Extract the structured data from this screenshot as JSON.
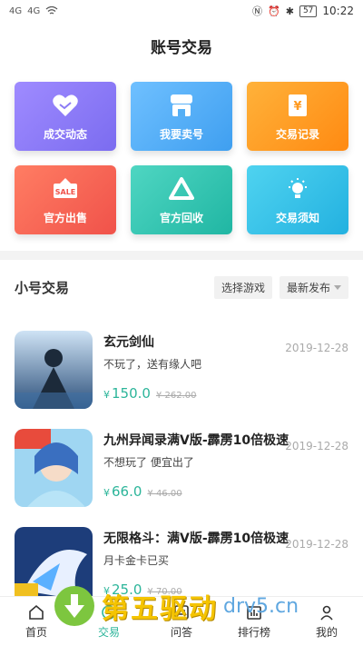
{
  "status": {
    "time": "10:22",
    "battery": "57",
    "signal1": "4G",
    "signal2": "4G"
  },
  "page_title": "账号交易",
  "tiles": [
    {
      "label": "成交动态",
      "icon": "handshake-icon"
    },
    {
      "label": "我要卖号",
      "icon": "shop-icon"
    },
    {
      "label": "交易记录",
      "icon": "receipt-icon"
    },
    {
      "label": "官方出售",
      "icon": "sale-tag-icon",
      "badge": "SALE"
    },
    {
      "label": "官方回收",
      "icon": "recycle-icon"
    },
    {
      "label": "交易须知",
      "icon": "lightbulb-icon"
    }
  ],
  "section": {
    "title": "小号交易",
    "filter_game": "选择游戏",
    "sort": "最新发布"
  },
  "items": [
    {
      "name": "玄元剑仙",
      "desc": "不玩了，送有缘人吧",
      "currency": "¥",
      "price": "150.0",
      "old_price": "¥ 262.00",
      "date": "2019-12-28"
    },
    {
      "name": "九州异闻录满V版-霹雳10倍极速",
      "desc": "不想玩了  便宜出了",
      "currency": "¥",
      "price": "66.0",
      "old_price": "¥ 46.00",
      "date": "2019-12-28"
    },
    {
      "name": "无限格斗：满V版-霹雳10倍极速",
      "desc": "月卡金卡已买",
      "currency": "¥",
      "price": "25.0",
      "old_price": "¥ 70.00",
      "date": "2019-12-28"
    }
  ],
  "tabbar": [
    {
      "label": "首页",
      "icon": "home-icon"
    },
    {
      "label": "交易",
      "icon": "trade-icon"
    },
    {
      "label": "问答",
      "icon": "qa-icon"
    },
    {
      "label": "排行榜",
      "icon": "ranking-icon"
    },
    {
      "label": "我的",
      "icon": "user-icon"
    }
  ],
  "watermark": {
    "text": "第五驱动",
    "url": "drv5.cn"
  },
  "colors": {
    "accent": "#2cb59a"
  }
}
